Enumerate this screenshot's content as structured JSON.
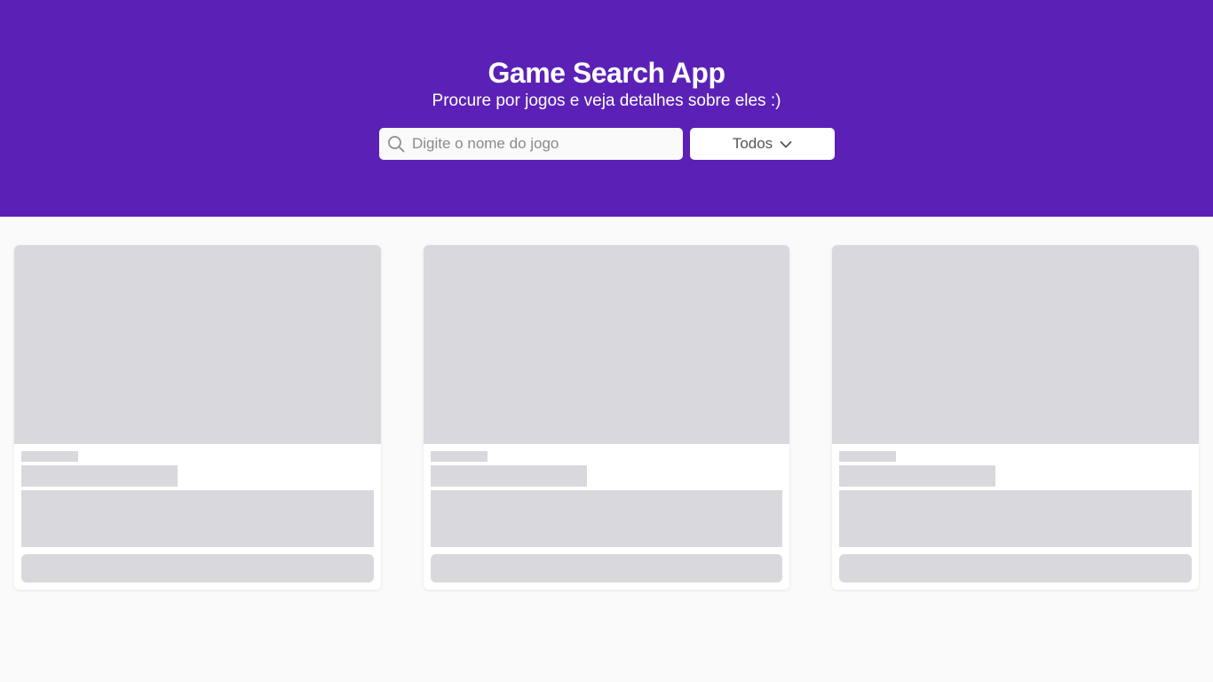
{
  "header": {
    "title": "Game Search App",
    "subtitle": "Procure por jogos e veja detalhes sobre eles :)",
    "background_color": "#5b21b6"
  },
  "search": {
    "placeholder": "Digite o nome do jogo",
    "value": "",
    "icon": "search-icon"
  },
  "filter": {
    "selected": "Todos",
    "icon": "chevron-down-icon"
  },
  "cards": [
    {
      "state": "loading-skeleton"
    },
    {
      "state": "loading-skeleton"
    },
    {
      "state": "loading-skeleton"
    }
  ],
  "colors": {
    "skeleton": "#d9d8dd",
    "page_background": "#fafafa"
  }
}
